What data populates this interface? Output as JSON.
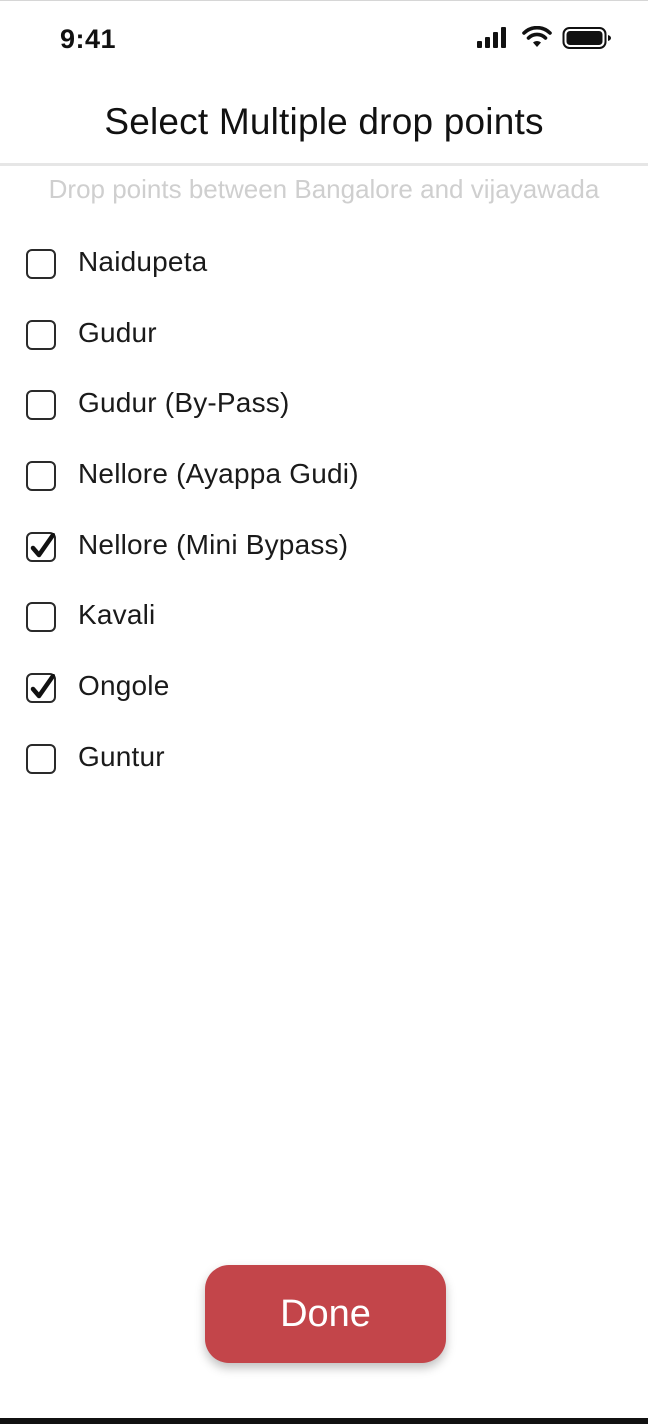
{
  "status_bar": {
    "time": "9:41",
    "icons": [
      "signal-icon",
      "wifi-icon",
      "battery-icon"
    ]
  },
  "header": {
    "title": "Select Multiple drop points",
    "subtitle": "Drop points between Bangalore and vijayawada"
  },
  "drop_points": [
    {
      "label": "Naidupeta",
      "checked": false
    },
    {
      "label": "Gudur",
      "checked": false
    },
    {
      "label": "Gudur (By-Pass)",
      "checked": false
    },
    {
      "label": "Nellore (Ayappa Gudi)",
      "checked": false
    },
    {
      "label": "Nellore (Mini Bypass)",
      "checked": true
    },
    {
      "label": "Kavali",
      "checked": false
    },
    {
      "label": "Ongole",
      "checked": true
    },
    {
      "label": "Guntur",
      "checked": false
    }
  ],
  "footer": {
    "done_label": "Done"
  },
  "colors": {
    "accent": "#c3454a",
    "subtitle": "#cfcfcf",
    "text": "#111111"
  }
}
